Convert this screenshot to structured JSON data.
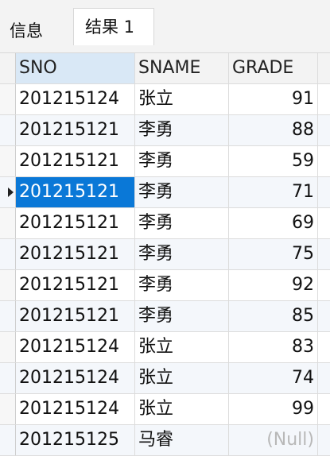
{
  "tabs": [
    {
      "label": "信息"
    },
    {
      "label": "结果 1"
    }
  ],
  "table": {
    "columns": [
      "SNO",
      "SNAME",
      "GRADE"
    ],
    "rows": [
      {
        "sno": "201215124",
        "sname": "张立",
        "grade": "91"
      },
      {
        "sno": "201215121",
        "sname": "李勇",
        "grade": "88"
      },
      {
        "sno": "201215121",
        "sname": "李勇",
        "grade": "59"
      },
      {
        "sno": "201215121",
        "sname": "李勇",
        "grade": "71"
      },
      {
        "sno": "201215121",
        "sname": "李勇",
        "grade": "69"
      },
      {
        "sno": "201215121",
        "sname": "李勇",
        "grade": "75"
      },
      {
        "sno": "201215121",
        "sname": "李勇",
        "grade": "92"
      },
      {
        "sno": "201215121",
        "sname": "李勇",
        "grade": "85"
      },
      {
        "sno": "201215124",
        "sname": "张立",
        "grade": "83"
      },
      {
        "sno": "201215124",
        "sname": "张立",
        "grade": "74"
      },
      {
        "sno": "201215124",
        "sname": "张立",
        "grade": "99"
      },
      {
        "sno": "201215125",
        "sname": "马睿",
        "grade": "(Null)"
      }
    ],
    "selected_row": 3,
    "colors": {
      "selection": "#0a78d7",
      "header_active": "#d9e8f6",
      "null_text": "#b8b8b8"
    }
  }
}
